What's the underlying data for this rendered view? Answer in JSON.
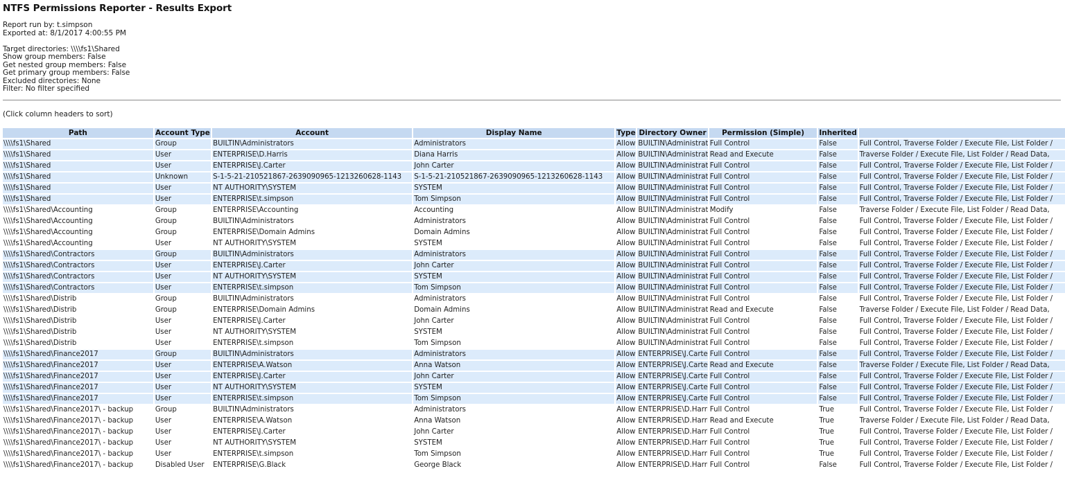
{
  "title": "NTFS Permissions Reporter - Results Export",
  "report_info": {
    "run_by": "Report run by: t.simpson",
    "exported_at": "Exported at: 8/1/2017 4:00:55 PM"
  },
  "settings": [
    "Target directories: \\\\\\\\fs1\\Shared",
    "Show group members: False",
    "Get nested group members: False",
    "Get primary group members: False",
    "Excluded directories: None",
    "Filter: No filter specified"
  ],
  "sort_hint": "(Click column headers to sort)",
  "table": {
    "headers": [
      "Path",
      "Account Type",
      "Account",
      "Display Name",
      "Type",
      "Directory Owner",
      "Permission (Simple)",
      "Inherited",
      ""
    ],
    "colors": {
      "header_bg": "#c5d9f1",
      "shaded_row_bg": "#dcebfb",
      "plain_row_bg": "#ffffff"
    },
    "rows": [
      {
        "shade": true,
        "cells": [
          "\\\\\\\\fs1\\Shared",
          "Group",
          "BUILTIN\\Administrators",
          "Administrators",
          "Allow",
          "BUILTIN\\Administrators",
          "Full Control",
          "False",
          "Full Control, Traverse Folder / Execute File, List Folder /"
        ]
      },
      {
        "shade": true,
        "cells": [
          "\\\\\\\\fs1\\Shared",
          "User",
          "ENTERPRISE\\D.Harris",
          "Diana Harris",
          "Allow",
          "BUILTIN\\Administrators",
          "Read and Execute",
          "False",
          "Traverse Folder / Execute File, List Folder / Read Data,"
        ]
      },
      {
        "shade": true,
        "cells": [
          "\\\\\\\\fs1\\Shared",
          "User",
          "ENTERPRISE\\J.Carter",
          "John Carter",
          "Allow",
          "BUILTIN\\Administrators",
          "Full Control",
          "False",
          "Full Control, Traverse Folder / Execute File, List Folder /"
        ]
      },
      {
        "shade": true,
        "cells": [
          "\\\\\\\\fs1\\Shared",
          "Unknown",
          "S-1-5-21-210521867-2639090965-1213260628-1143",
          "S-1-5-21-210521867-2639090965-1213260628-1143",
          "Allow",
          "BUILTIN\\Administrators",
          "Full Control",
          "False",
          "Full Control, Traverse Folder / Execute File, List Folder /"
        ]
      },
      {
        "shade": true,
        "cells": [
          "\\\\\\\\fs1\\Shared",
          "User",
          "NT AUTHORITY\\SYSTEM",
          "SYSTEM",
          "Allow",
          "BUILTIN\\Administrators",
          "Full Control",
          "False",
          "Full Control, Traverse Folder / Execute File, List Folder /"
        ]
      },
      {
        "shade": true,
        "cells": [
          "\\\\\\\\fs1\\Shared",
          "User",
          "ENTERPRISE\\t.simpson",
          "Tom Simpson",
          "Allow",
          "BUILTIN\\Administrators",
          "Full Control",
          "False",
          "Full Control, Traverse Folder / Execute File, List Folder /"
        ]
      },
      {
        "shade": false,
        "cells": [
          "\\\\\\\\fs1\\Shared\\Accounting",
          "Group",
          "ENTERPRISE\\Accounting",
          "Accounting",
          "Allow",
          "BUILTIN\\Administrators",
          "Modify",
          "False",
          "Traverse Folder / Execute File, List Folder / Read Data,"
        ]
      },
      {
        "shade": false,
        "cells": [
          "\\\\\\\\fs1\\Shared\\Accounting",
          "Group",
          "BUILTIN\\Administrators",
          "Administrators",
          "Allow",
          "BUILTIN\\Administrators",
          "Full Control",
          "False",
          "Full Control, Traverse Folder / Execute File, List Folder /"
        ]
      },
      {
        "shade": false,
        "cells": [
          "\\\\\\\\fs1\\Shared\\Accounting",
          "Group",
          "ENTERPRISE\\Domain Admins",
          "Domain Admins",
          "Allow",
          "BUILTIN\\Administrators",
          "Full Control",
          "False",
          "Full Control, Traverse Folder / Execute File, List Folder /"
        ]
      },
      {
        "shade": false,
        "cells": [
          "\\\\\\\\fs1\\Shared\\Accounting",
          "User",
          "NT AUTHORITY\\SYSTEM",
          "SYSTEM",
          "Allow",
          "BUILTIN\\Administrators",
          "Full Control",
          "False",
          "Full Control, Traverse Folder / Execute File, List Folder /"
        ]
      },
      {
        "shade": true,
        "cells": [
          "\\\\\\\\fs1\\Shared\\Contractors",
          "Group",
          "BUILTIN\\Administrators",
          "Administrators",
          "Allow",
          "BUILTIN\\Administrators",
          "Full Control",
          "False",
          "Full Control, Traverse Folder / Execute File, List Folder /"
        ]
      },
      {
        "shade": true,
        "cells": [
          "\\\\\\\\fs1\\Shared\\Contractors",
          "User",
          "ENTERPRISE\\J.Carter",
          "John Carter",
          "Allow",
          "BUILTIN\\Administrators",
          "Full Control",
          "False",
          "Full Control, Traverse Folder / Execute File, List Folder /"
        ]
      },
      {
        "shade": true,
        "cells": [
          "\\\\\\\\fs1\\Shared\\Contractors",
          "User",
          "NT AUTHORITY\\SYSTEM",
          "SYSTEM",
          "Allow",
          "BUILTIN\\Administrators",
          "Full Control",
          "False",
          "Full Control, Traverse Folder / Execute File, List Folder /"
        ]
      },
      {
        "shade": true,
        "cells": [
          "\\\\\\\\fs1\\Shared\\Contractors",
          "User",
          "ENTERPRISE\\t.simpson",
          "Tom Simpson",
          "Allow",
          "BUILTIN\\Administrators",
          "Full Control",
          "False",
          "Full Control, Traverse Folder / Execute File, List Folder /"
        ]
      },
      {
        "shade": false,
        "cells": [
          "\\\\\\\\fs1\\Shared\\Distrib",
          "Group",
          "BUILTIN\\Administrators",
          "Administrators",
          "Allow",
          "BUILTIN\\Administrators",
          "Full Control",
          "False",
          "Full Control, Traverse Folder / Execute File, List Folder /"
        ]
      },
      {
        "shade": false,
        "cells": [
          "\\\\\\\\fs1\\Shared\\Distrib",
          "Group",
          "ENTERPRISE\\Domain Admins",
          "Domain Admins",
          "Allow",
          "BUILTIN\\Administrators",
          "Read and Execute",
          "False",
          "Traverse Folder / Execute File, List Folder / Read Data,"
        ]
      },
      {
        "shade": false,
        "cells": [
          "\\\\\\\\fs1\\Shared\\Distrib",
          "User",
          "ENTERPRISE\\J.Carter",
          "John Carter",
          "Allow",
          "BUILTIN\\Administrators",
          "Full Control",
          "False",
          "Full Control, Traverse Folder / Execute File, List Folder /"
        ]
      },
      {
        "shade": false,
        "cells": [
          "\\\\\\\\fs1\\Shared\\Distrib",
          "User",
          "NT AUTHORITY\\SYSTEM",
          "SYSTEM",
          "Allow",
          "BUILTIN\\Administrators",
          "Full Control",
          "False",
          "Full Control, Traverse Folder / Execute File, List Folder /"
        ]
      },
      {
        "shade": false,
        "cells": [
          "\\\\\\\\fs1\\Shared\\Distrib",
          "User",
          "ENTERPRISE\\t.simpson",
          "Tom Simpson",
          "Allow",
          "BUILTIN\\Administrators",
          "Full Control",
          "False",
          "Full Control, Traverse Folder / Execute File, List Folder /"
        ]
      },
      {
        "shade": true,
        "cells": [
          "\\\\\\\\fs1\\Shared\\Finance2017",
          "Group",
          "BUILTIN\\Administrators",
          "Administrators",
          "Allow",
          "ENTERPRISE\\J.Carter",
          "Full Control",
          "False",
          "Full Control, Traverse Folder / Execute File, List Folder /"
        ]
      },
      {
        "shade": true,
        "cells": [
          "\\\\\\\\fs1\\Shared\\Finance2017",
          "User",
          "ENTERPRISE\\A.Watson",
          "Anna Watson",
          "Allow",
          "ENTERPRISE\\J.Carter",
          "Read and Execute",
          "False",
          "Traverse Folder / Execute File, List Folder / Read Data,"
        ]
      },
      {
        "shade": true,
        "cells": [
          "\\\\\\\\fs1\\Shared\\Finance2017",
          "User",
          "ENTERPRISE\\J.Carter",
          "John Carter",
          "Allow",
          "ENTERPRISE\\J.Carter",
          "Full Control",
          "False",
          "Full Control, Traverse Folder / Execute File, List Folder /"
        ]
      },
      {
        "shade": true,
        "cells": [
          "\\\\\\\\fs1\\Shared\\Finance2017",
          "User",
          "NT AUTHORITY\\SYSTEM",
          "SYSTEM",
          "Allow",
          "ENTERPRISE\\J.Carter",
          "Full Control",
          "False",
          "Full Control, Traverse Folder / Execute File, List Folder /"
        ]
      },
      {
        "shade": true,
        "cells": [
          "\\\\\\\\fs1\\Shared\\Finance2017",
          "User",
          "ENTERPRISE\\t.simpson",
          "Tom Simpson",
          "Allow",
          "ENTERPRISE\\J.Carter",
          "Full Control",
          "False",
          "Full Control, Traverse Folder / Execute File, List Folder /"
        ]
      },
      {
        "shade": false,
        "cells": [
          "\\\\\\\\fs1\\Shared\\Finance2017\\ - backup",
          "Group",
          "BUILTIN\\Administrators",
          "Administrators",
          "Allow",
          "ENTERPRISE\\D.Harris",
          "Full Control",
          "True",
          "Full Control, Traverse Folder / Execute File, List Folder /"
        ]
      },
      {
        "shade": false,
        "cells": [
          "\\\\\\\\fs1\\Shared\\Finance2017\\ - backup",
          "User",
          "ENTERPRISE\\A.Watson",
          "Anna Watson",
          "Allow",
          "ENTERPRISE\\D.Harris",
          "Read and Execute",
          "True",
          "Traverse Folder / Execute File, List Folder / Read Data,"
        ]
      },
      {
        "shade": false,
        "cells": [
          "\\\\\\\\fs1\\Shared\\Finance2017\\ - backup",
          "User",
          "ENTERPRISE\\J.Carter",
          "John Carter",
          "Allow",
          "ENTERPRISE\\D.Harris",
          "Full Control",
          "True",
          "Full Control, Traverse Folder / Execute File, List Folder /"
        ]
      },
      {
        "shade": false,
        "cells": [
          "\\\\\\\\fs1\\Shared\\Finance2017\\ - backup",
          "User",
          "NT AUTHORITY\\SYSTEM",
          "SYSTEM",
          "Allow",
          "ENTERPRISE\\D.Harris",
          "Full Control",
          "True",
          "Full Control, Traverse Folder / Execute File, List Folder /"
        ]
      },
      {
        "shade": false,
        "cells": [
          "\\\\\\\\fs1\\Shared\\Finance2017\\ - backup",
          "User",
          "ENTERPRISE\\t.simpson",
          "Tom Simpson",
          "Allow",
          "ENTERPRISE\\D.Harris",
          "Full Control",
          "True",
          "Full Control, Traverse Folder / Execute File, List Folder /"
        ]
      },
      {
        "shade": false,
        "cells": [
          "\\\\\\\\fs1\\Shared\\Finance2017\\ - backup",
          "Disabled User",
          "ENTERPRISE\\G.Black",
          "George Black",
          "Allow",
          "ENTERPRISE\\D.Harris",
          "Full Control",
          "False",
          "Full Control, Traverse Folder / Execute File, List Folder /"
        ]
      }
    ]
  }
}
